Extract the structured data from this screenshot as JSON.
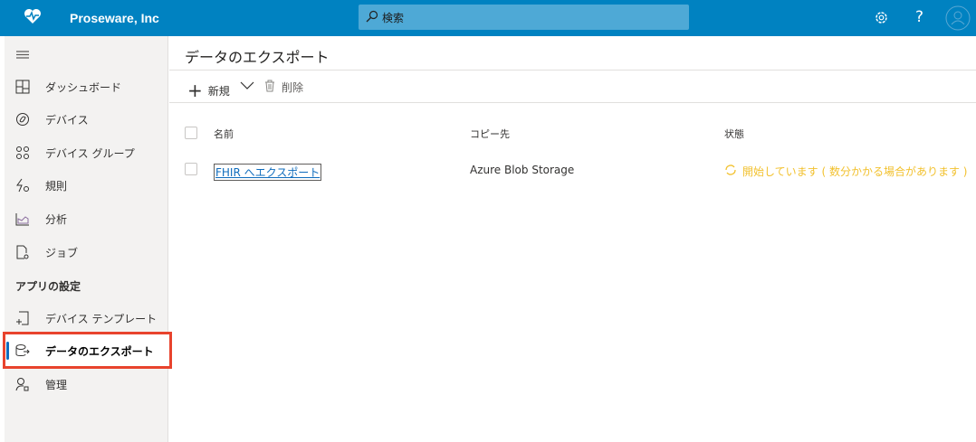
{
  "header": {
    "brand": "Proseware, Inc",
    "search_placeholder": "検索",
    "icons": [
      "heart-pulse-icon",
      "gear-icon",
      "help-icon",
      "avatar-icon"
    ],
    "color": "#0082c1"
  },
  "sidebar": {
    "items": [
      {
        "label": "ダッシュボード",
        "icon": "dashboard-icon"
      },
      {
        "label": "デバイス",
        "icon": "devices-icon"
      },
      {
        "label": "デバイス グループ",
        "icon": "device-groups-icon"
      },
      {
        "label": "規則",
        "icon": "rules-icon"
      },
      {
        "label": "分析",
        "icon": "analytics-icon"
      },
      {
        "label": "ジョブ",
        "icon": "jobs-icon"
      }
    ],
    "section": "アプリの設定",
    "settings_items": [
      {
        "label": "デバイス テンプレート",
        "icon": "device-template-icon"
      },
      {
        "label": "データのエクスポート",
        "icon": "data-export-icon",
        "active": true
      },
      {
        "label": "管理",
        "icon": "admin-icon"
      }
    ]
  },
  "main": {
    "title": "データのエクスポート",
    "toolbar": {
      "new": "新規",
      "delete": "削除"
    },
    "columns": [
      "名前",
      "コピー先",
      "状態"
    ],
    "rows": [
      {
        "name": "FHIR へエクスポート",
        "destination": "Azure Blob Storage",
        "status": "開始しています ( 数分かかる場合があります )"
      }
    ],
    "status_color": "#f2c12e"
  }
}
